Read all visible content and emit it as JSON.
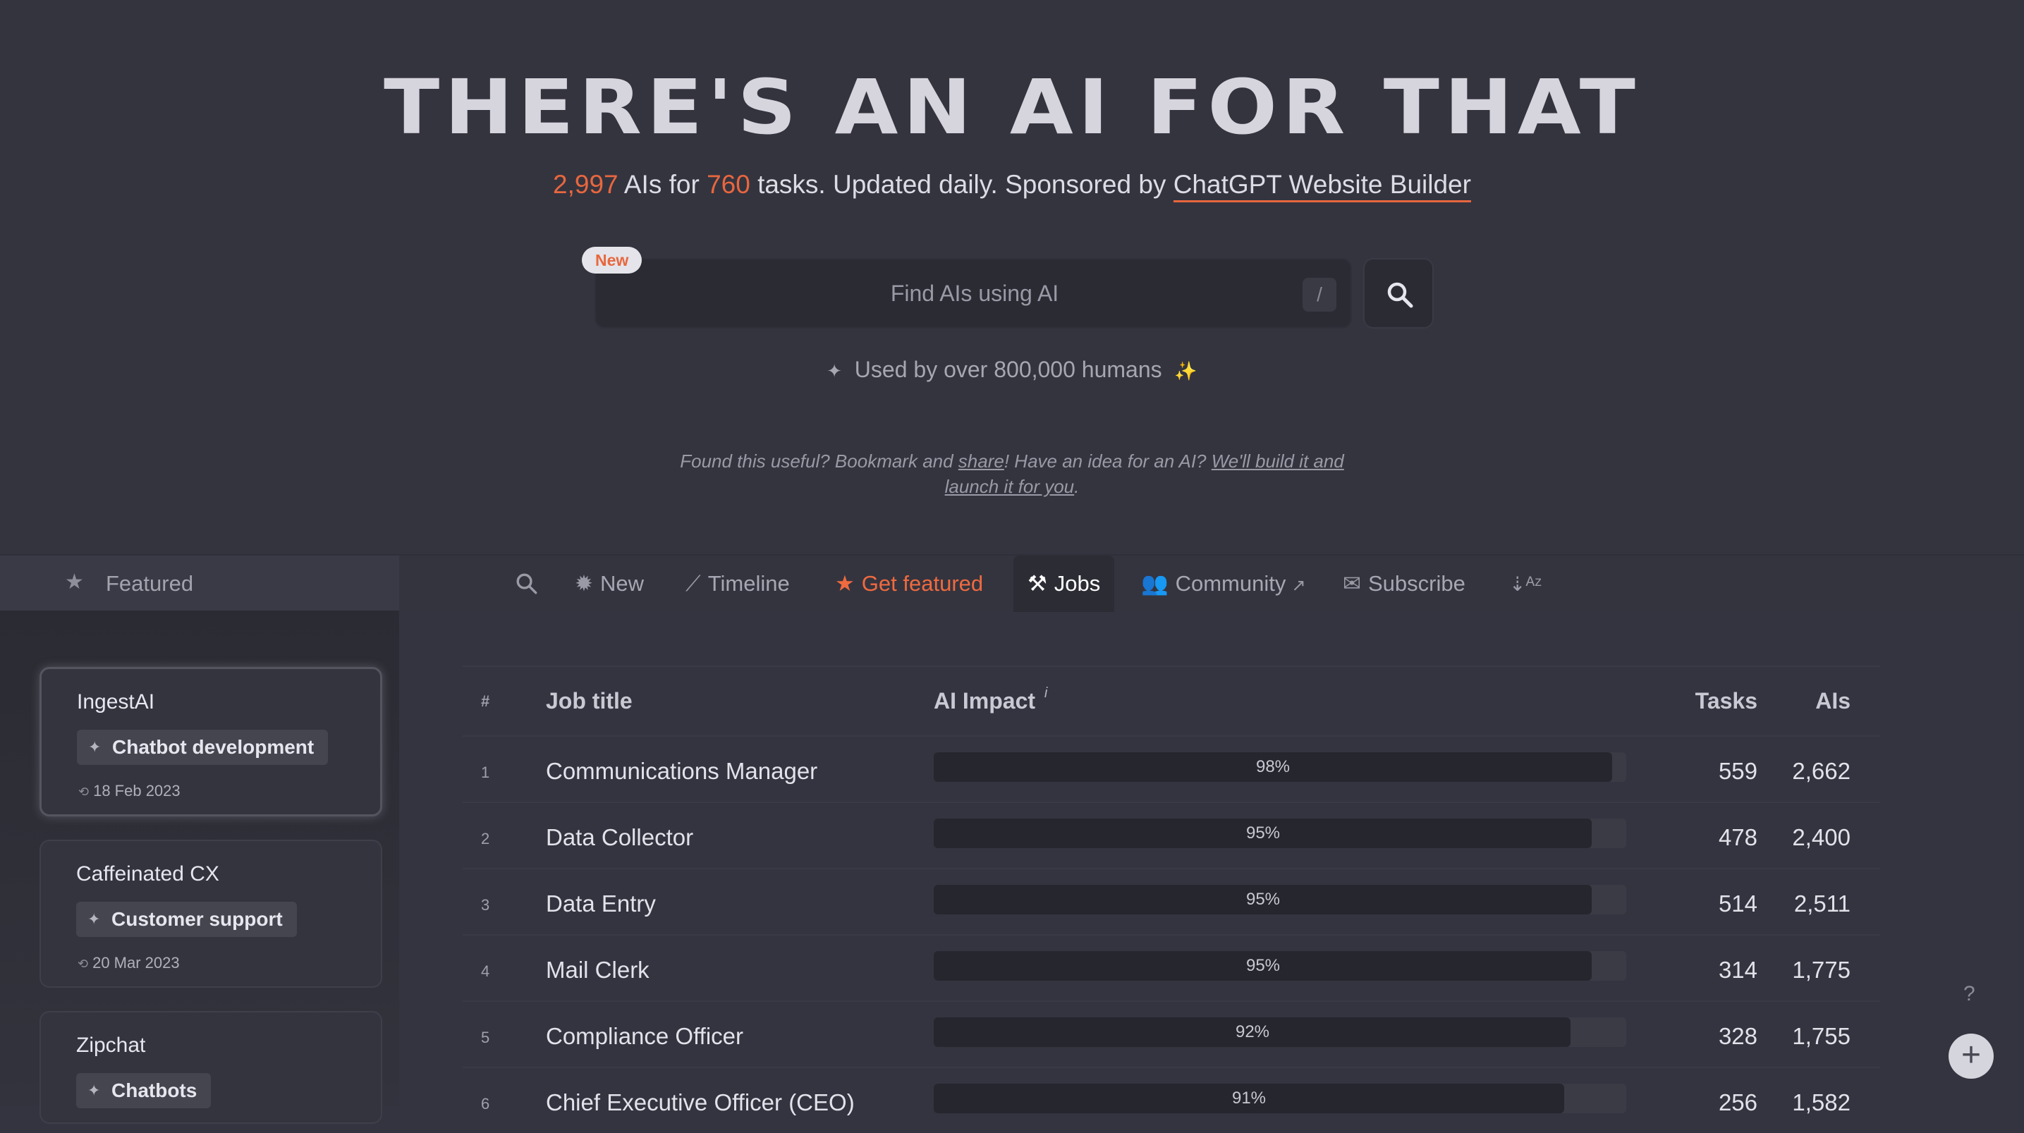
{
  "hero": {
    "title": "THERE'S AN AI FOR THAT",
    "ais_count": "2,997",
    "ais_text": " AIs for ",
    "tasks_count": "760",
    "tasks_text": " tasks. Updated daily. Sponsored by ",
    "sponsor": "ChatGPT Website Builder"
  },
  "search": {
    "badge": "New",
    "placeholder": "Find AIs using AI",
    "shortcut": "/",
    "button_icon": "search-icon"
  },
  "used_by": "Used by over 800,000 humans",
  "found": {
    "p1": "Found this useful? Bookmark and ",
    "share": "share",
    "p2": "! Have an idea for an AI? ",
    "link": "We'll build it and launch it for you",
    "p3": "."
  },
  "nav": {
    "featured": "Featured",
    "items": [
      {
        "label": "",
        "icon": "search-icon"
      },
      {
        "label": "New",
        "icon": "gear-badge-icon"
      },
      {
        "label": "Timeline",
        "icon": "trend-icon"
      },
      {
        "label": "Get featured",
        "icon": "star-icon"
      },
      {
        "label": "Jobs",
        "icon": "hammer-icon"
      },
      {
        "label": "Community",
        "icon": "users-icon"
      },
      {
        "label": "Subscribe",
        "icon": "mail-icon"
      },
      {
        "label": "",
        "icon": "sort-az-icon"
      }
    ]
  },
  "sidebar": {
    "cards": [
      {
        "name": "IngestAI",
        "tag": "Chatbot development",
        "date": "18 Feb 2023"
      },
      {
        "name": "Caffeinated CX",
        "tag": "Customer support",
        "date": "20 Mar 2023"
      },
      {
        "name": "Zipchat",
        "tag": "Chatbots",
        "date": ""
      }
    ]
  },
  "table": {
    "headers": {
      "hash": "#",
      "title": "Job title",
      "impact": "AI Impact",
      "info": "i",
      "tasks": "Tasks",
      "ais": "AIs"
    },
    "rows": [
      {
        "idx": "1",
        "title": "Communications Manager",
        "impact": 98,
        "impact_label": "98%",
        "tasks": "559",
        "ais": "2,662"
      },
      {
        "idx": "2",
        "title": "Data Collector",
        "impact": 95,
        "impact_label": "95%",
        "tasks": "478",
        "ais": "2,400"
      },
      {
        "idx": "3",
        "title": "Data Entry",
        "impact": 95,
        "impact_label": "95%",
        "tasks": "514",
        "ais": "2,511"
      },
      {
        "idx": "4",
        "title": "Mail Clerk",
        "impact": 95,
        "impact_label": "95%",
        "tasks": "314",
        "ais": "1,775"
      },
      {
        "idx": "5",
        "title": "Compliance Officer",
        "impact": 92,
        "impact_label": "92%",
        "tasks": "328",
        "ais": "1,755"
      },
      {
        "idx": "6",
        "title": "Chief Executive Officer (CEO)",
        "impact": 91,
        "impact_label": "91%",
        "tasks": "256",
        "ais": "1,582"
      }
    ]
  },
  "floating": {
    "help": "?",
    "add": "+"
  }
}
